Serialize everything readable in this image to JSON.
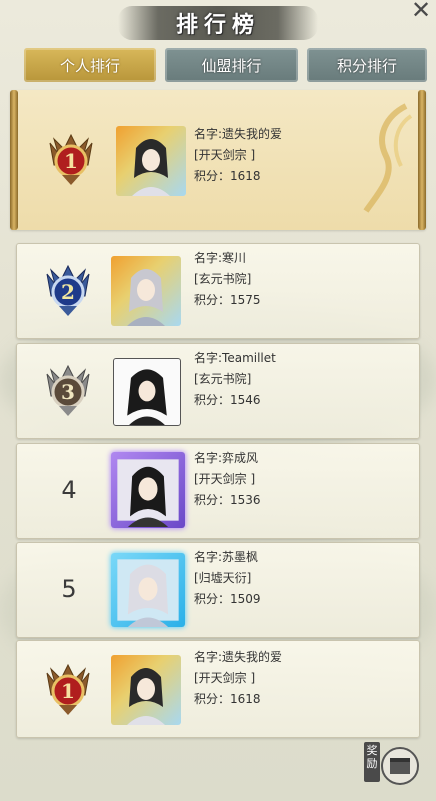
{
  "header": {
    "title": "排行榜",
    "close_icon": "close-icon"
  },
  "tabs": [
    {
      "label": "个人排行",
      "active": true
    },
    {
      "label": "仙盟排行",
      "active": false
    },
    {
      "label": "积分排行",
      "active": false
    }
  ],
  "ranking": [
    {
      "rank": "1",
      "name_line": "名字:遗失我的爱",
      "sect_line": "[开天剑宗 ]",
      "score_line": "积分：1618",
      "medal": "gold-medal-icon"
    },
    {
      "rank": "2",
      "name_line": "名字:寒川",
      "sect_line": "[玄元书院]",
      "score_line": "积分：1575",
      "medal": "blue-medal-icon"
    },
    {
      "rank": "3",
      "name_line": "名字:Teamillet",
      "sect_line": "[玄元书院]",
      "score_line": "积分：1546",
      "medal": "silver-medal-icon"
    },
    {
      "rank": "4",
      "name_line": "名字:弈成风",
      "sect_line": "[开天剑宗 ]",
      "score_line": "积分：1536"
    },
    {
      "rank": "5",
      "name_line": "名字:苏墨枫",
      "sect_line": "[归墟天衍]",
      "score_line": "积分：1509"
    }
  ],
  "my_rank": {
    "rank": "1",
    "name_line": "名字:遗失我的爱",
    "sect_line": "[开天剑宗 ]",
    "score_line": "积分：1618"
  },
  "reward": {
    "label": "奖励"
  },
  "colors": {
    "gold_tab": "#c9a648",
    "teal_tab": "#748888",
    "medal_gold": "#8b1a1a"
  }
}
